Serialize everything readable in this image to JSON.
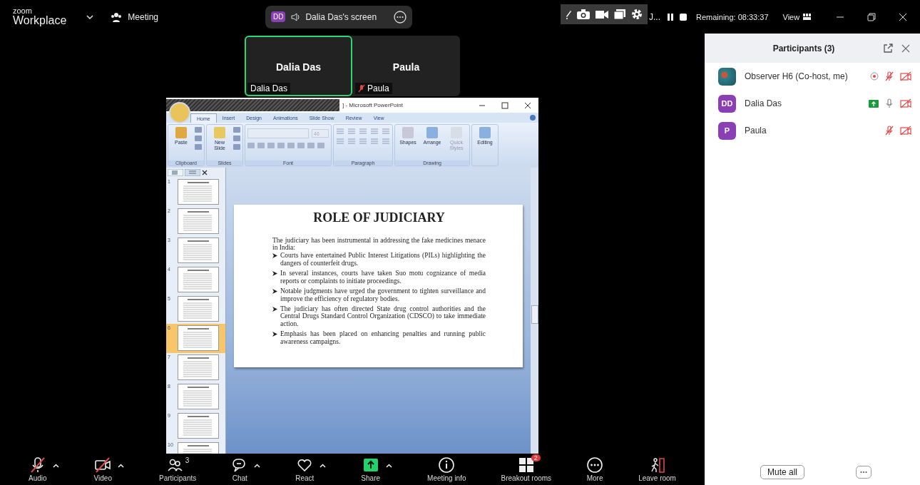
{
  "top_bar": {
    "logo_top": "zoom",
    "logo_bottom": "Workplace",
    "meeting_label": "Meeting",
    "share_pill": {
      "initials": "DD",
      "label": "Dalia Das's screen"
    },
    "presenter": "J...",
    "timer": "Remaining: 08:33:37",
    "view_label": "View"
  },
  "video_tiles": [
    {
      "name": "Dalia Das",
      "caption": "Dalia Das",
      "speaking": true,
      "muted": false
    },
    {
      "name": "Paula",
      "caption": "Paula",
      "speaking": false,
      "muted": true
    }
  ],
  "shared_window": {
    "title": "] - Microsoft PowerPoint",
    "tabs": [
      {
        "label": "Home",
        "selected": true
      },
      {
        "label": "Insert",
        "selected": false
      },
      {
        "label": "Design",
        "selected": false
      },
      {
        "label": "Animations",
        "selected": false
      },
      {
        "label": "Slide Show",
        "selected": false
      },
      {
        "label": "Review",
        "selected": false
      },
      {
        "label": "View",
        "selected": false
      }
    ],
    "ribbon_groups": [
      {
        "kind": "buttons",
        "label": "Clipboard",
        "buttons": [
          {
            "label": "Paste",
            "disabled": false
          }
        ]
      },
      {
        "kind": "buttons",
        "label": "Slides",
        "buttons": [
          {
            "label": "New Slide",
            "disabled": false
          }
        ]
      },
      {
        "kind": "font",
        "label": "Font",
        "font_size": "46"
      },
      {
        "kind": "paragraph",
        "label": "Paragraph"
      },
      {
        "kind": "buttons",
        "label": "Drawing",
        "buttons": [
          {
            "label": "Shapes",
            "disabled": false
          },
          {
            "label": "Arrange",
            "disabled": false
          },
          {
            "label": "Quick Styles",
            "disabled": true
          }
        ]
      },
      {
        "kind": "buttons",
        "buttons": [
          {
            "label": "Editing",
            "disabled": false
          }
        ]
      }
    ],
    "thumbnails": [
      {
        "number": "1",
        "selected": false
      },
      {
        "number": "2",
        "selected": false
      },
      {
        "number": "3",
        "selected": false
      },
      {
        "number": "4",
        "selected": false
      },
      {
        "number": "5",
        "selected": false
      },
      {
        "number": "6",
        "selected": true
      },
      {
        "number": "7",
        "selected": false
      },
      {
        "number": "8",
        "selected": false
      },
      {
        "number": "9",
        "selected": false
      },
      {
        "number": "10",
        "selected": false
      }
    ],
    "slide": {
      "title": "ROLE OF JUDICIARY",
      "intro": "The judiciary has been instrumental in addressing the fake medicines menace in India:",
      "bullets": [
        "Courts have entertained Public Interest Litigations (PILs) highlighting the dangers of counterfeit drugs.",
        "In several instances, courts have taken Suo motu cognizance of media reports or complaints to initiate proceedings.",
        "Notable judgments have urged the government to tighten surveillance and improve the efficiency of regulatory bodies.",
        "The judiciary has often directed State drug control authorities and the Central Drugs Standard Control Organization (CDSCO) to take immediate action.",
        "Emphasis has been placed on enhancing penalties and running public awareness campaigns."
      ]
    }
  },
  "toolbar": [
    {
      "kind": "mic",
      "label": "Audio",
      "off": true,
      "caret": true
    },
    {
      "kind": "camera",
      "label": "Video",
      "off": true,
      "caret": true
    },
    {
      "kind": "people",
      "label": "Participants",
      "count": "3"
    },
    {
      "kind": "chat",
      "label": "Chat",
      "caret": true
    },
    {
      "kind": "heart",
      "label": "React",
      "caret": true
    },
    {
      "kind": "share",
      "label": "Share",
      "caret": true
    },
    {
      "kind": "info",
      "label": "Meeting info"
    },
    {
      "kind": "grid",
      "label": "Breakout rooms",
      "badge": "2"
    },
    {
      "kind": "dots",
      "label": "More"
    },
    {
      "kind": "leave",
      "label": "Leave room"
    }
  ],
  "participants_panel": {
    "title": "Participants (3)",
    "participants": [
      {
        "name": "Observer H6 (Co-host, me)",
        "kind": "photo",
        "recording": true,
        "mic_muted": true,
        "video_off": true
      },
      {
        "name": "Dalia Das",
        "kind": "initials",
        "initials": "DD",
        "color": "#8b3fb5",
        "sharing": true,
        "mic_muted": false,
        "video_off": true
      },
      {
        "name": "Paula",
        "kind": "initials",
        "initials": "P",
        "color": "#8b3fb5",
        "mic_muted": true,
        "video_off": true
      }
    ],
    "mute_all": "Mute all"
  }
}
